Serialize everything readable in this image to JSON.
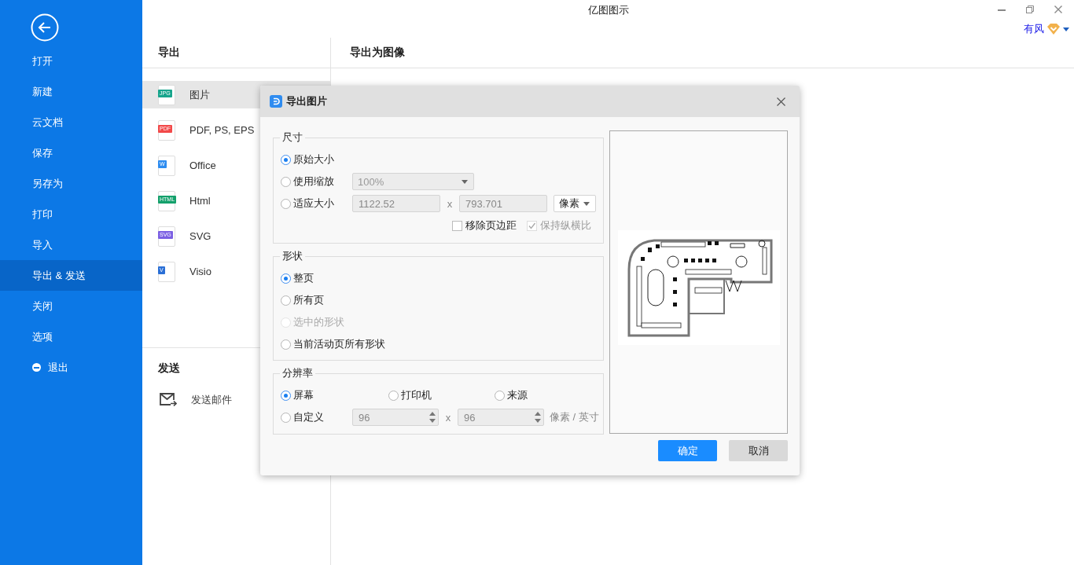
{
  "window": {
    "title": "亿图图示"
  },
  "user": {
    "name": "有风"
  },
  "sidebar": {
    "items": [
      {
        "label": "打开",
        "selected": false
      },
      {
        "label": "新建",
        "selected": false
      },
      {
        "label": "云文档",
        "selected": false
      },
      {
        "label": "保存",
        "selected": false
      },
      {
        "label": "另存为",
        "selected": false
      },
      {
        "label": "打印",
        "selected": false
      },
      {
        "label": "导入",
        "selected": false
      },
      {
        "label": "导出 & 发送",
        "selected": true
      },
      {
        "label": "关闭",
        "selected": false
      },
      {
        "label": "选项",
        "selected": false
      },
      {
        "label": "退出",
        "selected": false,
        "kind": "exit"
      }
    ]
  },
  "export_panel": {
    "heading": "导出",
    "formats": [
      {
        "label": "图片",
        "badge": "JPG",
        "color": "#17a58c",
        "selected": true
      },
      {
        "label": "PDF, PS, EPS",
        "badge": "PDF",
        "color": "#f24949",
        "selected": false
      },
      {
        "label": "Office",
        "badge": "W",
        "color": "#2d8cf0",
        "selected": false
      },
      {
        "label": "Html",
        "badge": "HTML",
        "color": "#13a06b",
        "selected": false
      },
      {
        "label": "SVG",
        "badge": "SVG",
        "color": "#7b5fe3",
        "selected": false
      },
      {
        "label": "Visio",
        "badge": "V",
        "color": "#2a6fd6",
        "selected": false
      }
    ],
    "send_heading": "发送",
    "send_items": [
      {
        "label": "发送邮件"
      }
    ]
  },
  "detail": {
    "heading": "导出为图像"
  },
  "dialog": {
    "title": "导出图片",
    "size": {
      "legend": "尺寸",
      "options": [
        {
          "label": "原始大小",
          "selected": true
        },
        {
          "label": "使用缩放",
          "selected": false
        },
        {
          "label": "适应大小",
          "selected": false
        }
      ],
      "scale": {
        "value": "100%",
        "disabled": true
      },
      "width": {
        "value": "1122.52",
        "disabled": true
      },
      "times": "x",
      "height": {
        "value": "793.701",
        "disabled": true
      },
      "unit": {
        "value": "像素",
        "disabled": false
      },
      "remove_margin": {
        "label": "移除页边距",
        "checked": false,
        "disabled": false
      },
      "keep_ratio": {
        "label": "保持纵横比",
        "checked": true,
        "disabled": true
      }
    },
    "shape": {
      "legend": "形状",
      "options": [
        {
          "label": "整页",
          "selected": true,
          "disabled": false
        },
        {
          "label": "所有页",
          "selected": false,
          "disabled": false
        },
        {
          "label": "选中的形状",
          "selected": false,
          "disabled": true
        },
        {
          "label": "当前活动页所有形状",
          "selected": false,
          "disabled": false
        }
      ]
    },
    "resolution": {
      "legend": "分辨率",
      "options": [
        {
          "label": "屏幕",
          "selected": true
        },
        {
          "label": "打印机",
          "selected": false
        },
        {
          "label": "来源",
          "selected": false
        },
        {
          "label": "自定义",
          "selected": false
        }
      ],
      "custom_x": {
        "value": "96",
        "disabled": true
      },
      "times": "x",
      "custom_y": {
        "value": "96",
        "disabled": true
      },
      "unit": "像素 / 英寸"
    },
    "buttons": [
      {
        "label": "确定",
        "kind": "primary"
      },
      {
        "label": "取消",
        "kind": "secondary"
      }
    ]
  }
}
